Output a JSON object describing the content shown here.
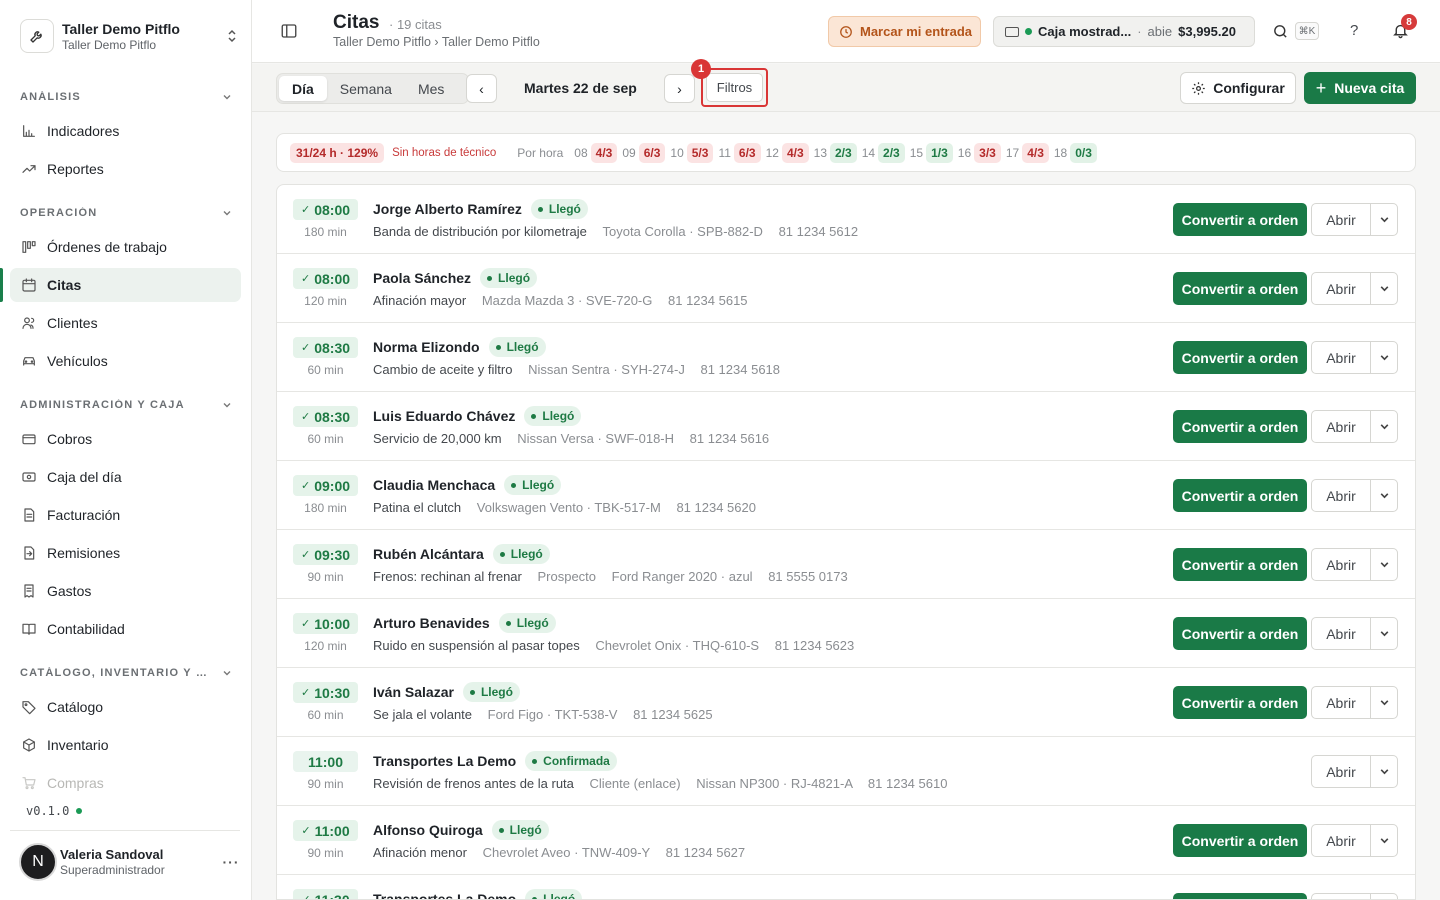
{
  "workspace": {
    "name": "Taller Demo Pitflo",
    "subtitle": "Taller Demo Pitflo"
  },
  "sidebar": {
    "sections": [
      {
        "title": "ANÁLISIS",
        "items": [
          {
            "label": "Indicadores",
            "icon": "bar-chart-icon"
          },
          {
            "label": "Reportes",
            "icon": "trend-up-icon"
          }
        ]
      },
      {
        "title": "OPERACIÓN",
        "items": [
          {
            "label": "Órdenes de trabajo",
            "icon": "kanban-icon"
          },
          {
            "label": "Citas",
            "icon": "calendar-icon"
          },
          {
            "label": "Clientes",
            "icon": "users-icon"
          },
          {
            "label": "Vehículos",
            "icon": "car-icon"
          }
        ]
      },
      {
        "title": "ADMINISTRACIÓN Y CAJA",
        "items": [
          {
            "label": "Cobros",
            "icon": "credit-card-icon"
          },
          {
            "label": "Caja del día",
            "icon": "cash-icon"
          },
          {
            "label": "Facturación",
            "icon": "invoice-icon"
          },
          {
            "label": "Remisiones",
            "icon": "file-arrow-icon"
          },
          {
            "label": "Gastos",
            "icon": "receipt-icon"
          },
          {
            "label": "Contabilidad",
            "icon": "book-icon"
          }
        ]
      },
      {
        "title": "CATÁLOGO, INVENTARIO Y CO...",
        "items": [
          {
            "label": "Catálogo",
            "icon": "tag-icon"
          },
          {
            "label": "Inventario",
            "icon": "box-icon"
          },
          {
            "label": "Compras",
            "icon": "cart-icon"
          }
        ]
      }
    ],
    "active": "Citas",
    "version": "v0.1.0",
    "user": {
      "initial": "N",
      "name": "Valeria Sandoval",
      "role": "Superadministrador"
    }
  },
  "header": {
    "title": "Citas",
    "count": "· 19 citas",
    "breadcrumb": "Taller Demo Pitflo › Taller Demo Pitflo",
    "clock_in": "Marcar mi entrada",
    "register": {
      "name": "Caja mostrad...",
      "status": "abie",
      "amount": "$3,995.20"
    },
    "shortcut": "⌘K",
    "help": "?",
    "notifications": "8"
  },
  "toolbar": {
    "views": [
      "Día",
      "Semana",
      "Mes"
    ],
    "active_view": "Día",
    "prev": "‹",
    "next": "›",
    "date": "Martes 22 de sep",
    "filters": "Filtros",
    "filters_marker": "1",
    "configure": "Configurar",
    "new": "Nueva cita"
  },
  "capacity": {
    "total": "31/24 h · 129%",
    "warning": "Sin horas de técnico",
    "label": "Por hora",
    "hours": [
      {
        "h": "08",
        "v": "4/3",
        "state": "red"
      },
      {
        "h": "09",
        "v": "6/3",
        "state": "red"
      },
      {
        "h": "10",
        "v": "5/3",
        "state": "red"
      },
      {
        "h": "11",
        "v": "6/3",
        "state": "red"
      },
      {
        "h": "12",
        "v": "4/3",
        "state": "red"
      },
      {
        "h": "13",
        "v": "2/3",
        "state": "green"
      },
      {
        "h": "14",
        "v": "2/3",
        "state": "green"
      },
      {
        "h": "15",
        "v": "1/3",
        "state": "green"
      },
      {
        "h": "16",
        "v": "3/3",
        "state": "red"
      },
      {
        "h": "17",
        "v": "4/3",
        "state": "red"
      },
      {
        "h": "18",
        "v": "0/3",
        "state": "green"
      }
    ]
  },
  "actions": {
    "convert": "Convertir a orden",
    "open": "Abrir"
  },
  "appointments": [
    {
      "time": "08:00",
      "checked": true,
      "duration": "180 min",
      "name": "Jorge Alberto Ramírez",
      "status": "Llegó",
      "service": "Banda de distribución por kilometraje",
      "extra": "",
      "vehicle": "Toyota Corolla · SPB-882-D",
      "phone": "81 1234 5612",
      "convert": true
    },
    {
      "time": "08:00",
      "checked": true,
      "duration": "120 min",
      "name": "Paola Sánchez",
      "status": "Llegó",
      "service": "Afinación mayor",
      "extra": "",
      "vehicle": "Mazda Mazda 3 · SVE-720-G",
      "phone": "81 1234 5615",
      "convert": true
    },
    {
      "time": "08:30",
      "checked": true,
      "duration": "60 min",
      "name": "Norma Elizondo",
      "status": "Llegó",
      "service": "Cambio de aceite y filtro",
      "extra": "",
      "vehicle": "Nissan Sentra · SYH-274-J",
      "phone": "81 1234 5618",
      "convert": true
    },
    {
      "time": "08:30",
      "checked": true,
      "duration": "60 min",
      "name": "Luis Eduardo Chávez",
      "status": "Llegó",
      "service": "Servicio de 20,000 km",
      "extra": "",
      "vehicle": "Nissan Versa · SWF-018-H",
      "phone": "81 1234 5616",
      "convert": true
    },
    {
      "time": "09:00",
      "checked": true,
      "duration": "180 min",
      "name": "Claudia Menchaca",
      "status": "Llegó",
      "service": "Patina el clutch",
      "extra": "",
      "vehicle": "Volkswagen Vento · TBK-517-M",
      "phone": "81 1234 5620",
      "convert": true
    },
    {
      "time": "09:30",
      "checked": true,
      "duration": "90 min",
      "name": "Rubén Alcántara",
      "status": "Llegó",
      "service": "Frenos: rechinan al frenar",
      "extra": "Prospecto",
      "vehicle": "Ford Ranger 2020 · azul",
      "phone": "81 5555 0173",
      "convert": true
    },
    {
      "time": "10:00",
      "checked": true,
      "duration": "120 min",
      "name": "Arturo Benavides",
      "status": "Llegó",
      "service": "Ruido en suspensión al pasar topes",
      "extra": "",
      "vehicle": "Chevrolet Onix · THQ-610-S",
      "phone": "81 1234 5623",
      "convert": true
    },
    {
      "time": "10:30",
      "checked": true,
      "duration": "60 min",
      "name": "Iván Salazar",
      "status": "Llegó",
      "service": "Se jala el volante",
      "extra": "",
      "vehicle": "Ford Figo · TKT-538-V",
      "phone": "81 1234 5625",
      "convert": true
    },
    {
      "time": "11:00",
      "checked": false,
      "duration": "90 min",
      "name": "Transportes La Demo",
      "status": "Confirmada",
      "service": "Revisión de frenos antes de la ruta",
      "extra": "Cliente (enlace)",
      "vehicle": "Nissan NP300 · RJ-4821-A",
      "phone": "81 1234 5610",
      "convert": false
    },
    {
      "time": "11:00",
      "checked": true,
      "duration": "90 min",
      "name": "Alfonso Quiroga",
      "status": "Llegó",
      "service": "Afinación menor",
      "extra": "",
      "vehicle": "Chevrolet Aveo · TNW-409-Y",
      "phone": "81 1234 5627",
      "convert": true
    },
    {
      "time": "11:30",
      "checked": true,
      "duration": "",
      "name": "Transportes La Demo",
      "status": "Llegó",
      "service": "",
      "extra": "",
      "vehicle": "",
      "phone": "",
      "convert": true
    }
  ]
}
